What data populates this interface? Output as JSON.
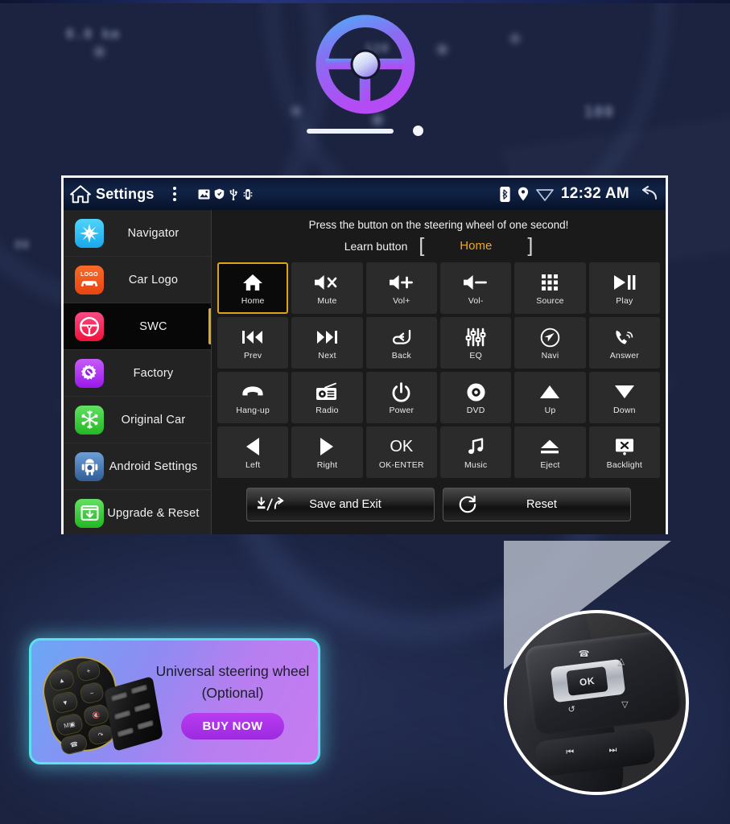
{
  "background": {
    "description": "blurred car dashboard instrument cluster"
  },
  "logo": {
    "icon": "steering-wheel-icon",
    "gradient_from": "#5aa8f8",
    "gradient_to": "#a855f7"
  },
  "head_unit": {
    "statusbar": {
      "home_icon": "home-icon",
      "title": "Settings",
      "menu_icon": "kebab-menu-icon",
      "left_icons": [
        "image-icon",
        "shield-icon",
        "usb-icon",
        "device-icon"
      ],
      "right_icons": [
        "bluetooth-icon",
        "location-pin-icon",
        "wifi-icon"
      ],
      "time": "12:32 AM",
      "back_icon": "back-arrow-icon"
    },
    "sidebar": {
      "items": [
        {
          "label": "Navigator",
          "icon": "compass-icon",
          "color": "#2fc0f5",
          "active": false
        },
        {
          "label": "Car Logo",
          "icon": "car-logo-icon",
          "color": "#f0541f",
          "active": false
        },
        {
          "label": "SWC",
          "icon": "steering-wheel-icon",
          "color": "#f0245c",
          "active": true
        },
        {
          "label": "Factory",
          "icon": "gear-wrench-icon",
          "color": "#b03cf5",
          "active": false
        },
        {
          "label": "Original Car",
          "icon": "snowflake-icon",
          "color": "#3ccf3c",
          "active": false
        },
        {
          "label": "Android Settings",
          "icon": "android-icon",
          "color": "#4a82c8",
          "active": false
        },
        {
          "label": "Upgrade & Reset",
          "icon": "download-box-icon",
          "color": "#3ccf3c",
          "active": false
        }
      ]
    },
    "main": {
      "hint": "Press the button on the steering wheel of one second!",
      "learn_label": "Learn button",
      "bracket_open": "[",
      "bracket_close": "]",
      "learn_value": "Home",
      "accent_color": "#e8a92c",
      "buttons": [
        {
          "label": "Home",
          "icon": "home-icon",
          "selected": true
        },
        {
          "label": "Mute",
          "icon": "volume-mute-icon",
          "selected": false
        },
        {
          "label": "Vol+",
          "icon": "volume-up-icon",
          "selected": false
        },
        {
          "label": "Vol-",
          "icon": "volume-down-icon",
          "selected": false
        },
        {
          "label": "Source",
          "icon": "grid-apps-icon",
          "selected": false
        },
        {
          "label": "Play",
          "icon": "play-pause-icon",
          "selected": false
        },
        {
          "label": "Prev",
          "icon": "previous-track-icon",
          "selected": false
        },
        {
          "label": "Next",
          "icon": "next-track-icon",
          "selected": false
        },
        {
          "label": "Back",
          "icon": "back-return-icon",
          "selected": false
        },
        {
          "label": "EQ",
          "icon": "equalizer-icon",
          "selected": false
        },
        {
          "label": "Navi",
          "icon": "navigation-icon",
          "selected": false
        },
        {
          "label": "Answer",
          "icon": "phone-answer-icon",
          "selected": false
        },
        {
          "label": "Hang-up",
          "icon": "phone-hangup-icon",
          "selected": false
        },
        {
          "label": "Radio",
          "icon": "radio-icon",
          "selected": false
        },
        {
          "label": "Power",
          "icon": "power-icon",
          "selected": false
        },
        {
          "label": "DVD",
          "icon": "disc-icon",
          "selected": false
        },
        {
          "label": "Up",
          "icon": "triangle-up-icon",
          "selected": false
        },
        {
          "label": "Down",
          "icon": "triangle-down-icon",
          "selected": false
        },
        {
          "label": "Left",
          "icon": "triangle-left-icon",
          "selected": false
        },
        {
          "label": "Right",
          "icon": "triangle-right-icon",
          "selected": false
        },
        {
          "label": "OK-ENTER",
          "icon": "ok-text-icon",
          "icon_text": "OK",
          "selected": false
        },
        {
          "label": "Music",
          "icon": "music-note-icon",
          "selected": false
        },
        {
          "label": "Eject",
          "icon": "eject-icon",
          "selected": false
        },
        {
          "label": "Backlight",
          "icon": "backlight-off-icon",
          "selected": false
        }
      ],
      "actions": [
        {
          "label": "Save and Exit",
          "icon": "save-exit-icon"
        },
        {
          "label": "Reset",
          "icon": "reset-circular-arrow-icon"
        }
      ]
    }
  },
  "photo_inset": {
    "description": "steering wheel control buttons close-up",
    "ok_label": "OK"
  },
  "promo": {
    "title_line1": "Universal steering wheel",
    "title_line2": "(Optional)",
    "cta_label": "BUY NOW",
    "border_color": "#5ce1f0",
    "cta_color": "#a32ae5",
    "product_icon": "steering-wheel-remote-icon"
  }
}
